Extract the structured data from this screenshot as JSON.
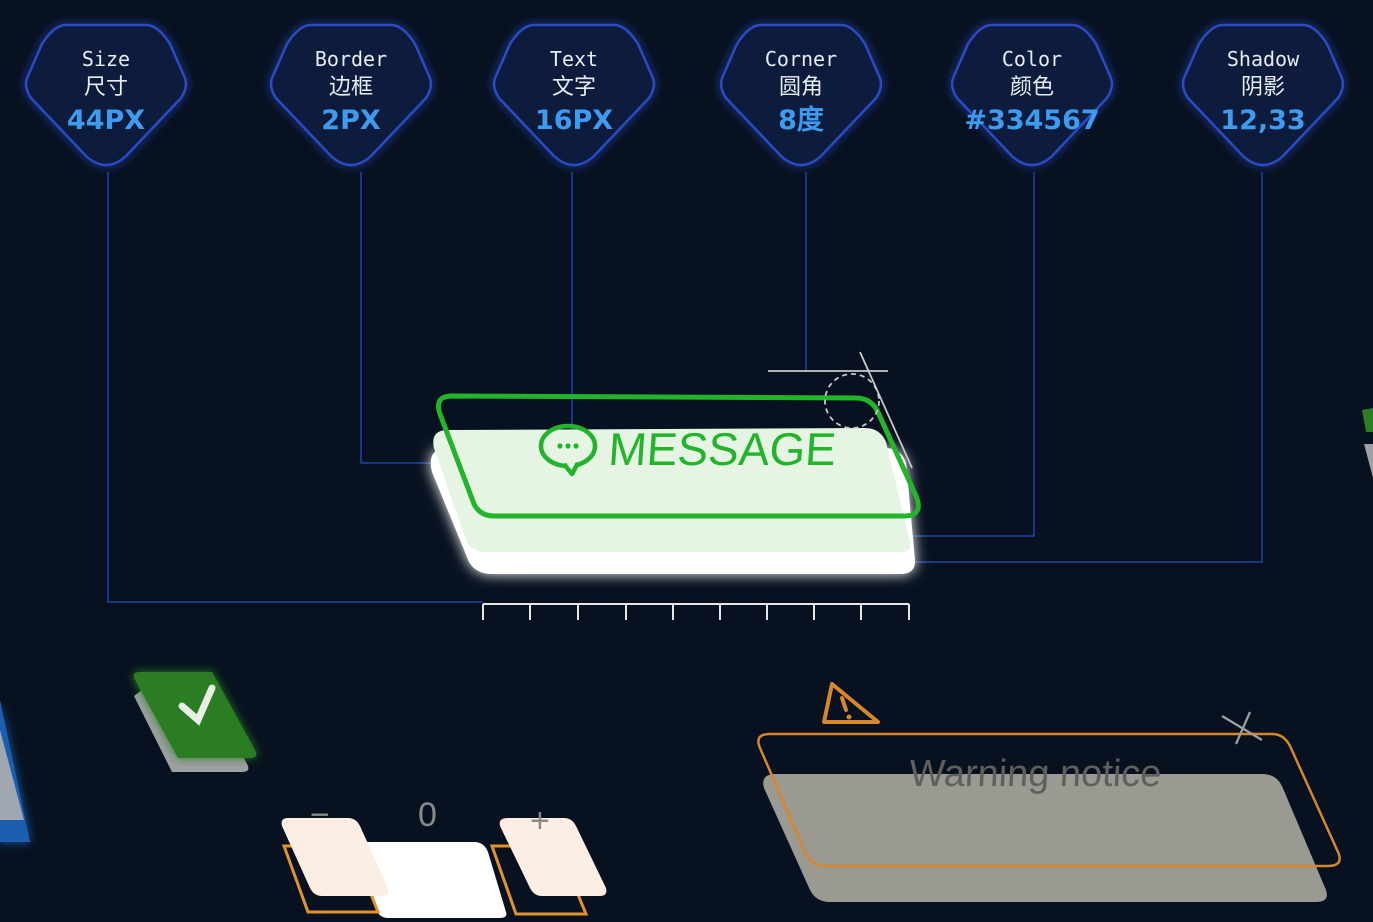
{
  "badges": [
    {
      "id": "size",
      "title": "Size",
      "sub": "尺寸",
      "value": "44PX"
    },
    {
      "id": "border",
      "title": "Border",
      "sub": "边框",
      "value": "2PX"
    },
    {
      "id": "text",
      "title": "Text",
      "sub": "文字",
      "value": "16PX"
    },
    {
      "id": "corner",
      "title": "Corner",
      "sub": "圆角",
      "value": "8度"
    },
    {
      "id": "color",
      "title": "Color",
      "sub": "颜色",
      "value": "#334567"
    },
    {
      "id": "shadow",
      "title": "Shadow",
      "sub": "阴影",
      "value": "12,33"
    }
  ],
  "message_button": {
    "label": "MESSAGE",
    "icon": "chat-bubble-icon"
  },
  "stepper": {
    "value": "0",
    "decrement": "−",
    "increment": "+"
  },
  "checkbox": {
    "icon": "check-icon",
    "checked": true
  },
  "warning": {
    "text": "Warning notice",
    "icon": "warning-icon",
    "close_icon": "close-icon"
  },
  "colors": {
    "background": "#07111f",
    "badge_fill": "#0b1a3d",
    "badge_stroke": "#2c4bc4",
    "accent_green": "#22b42a",
    "value_blue": "#3e9cf0",
    "warning_orange": "#d8862c"
  }
}
